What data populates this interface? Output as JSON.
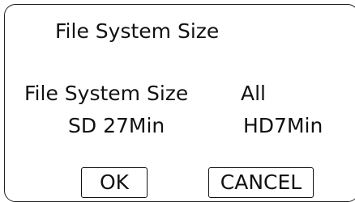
{
  "dialog": {
    "title": "File System Size",
    "rows": [
      {
        "label": "File System Size",
        "value": "All"
      },
      {
        "label": "SD 27Min",
        "value": "HD7Min"
      }
    ],
    "buttons": {
      "ok": "OK",
      "cancel": "CANCEL"
    }
  }
}
